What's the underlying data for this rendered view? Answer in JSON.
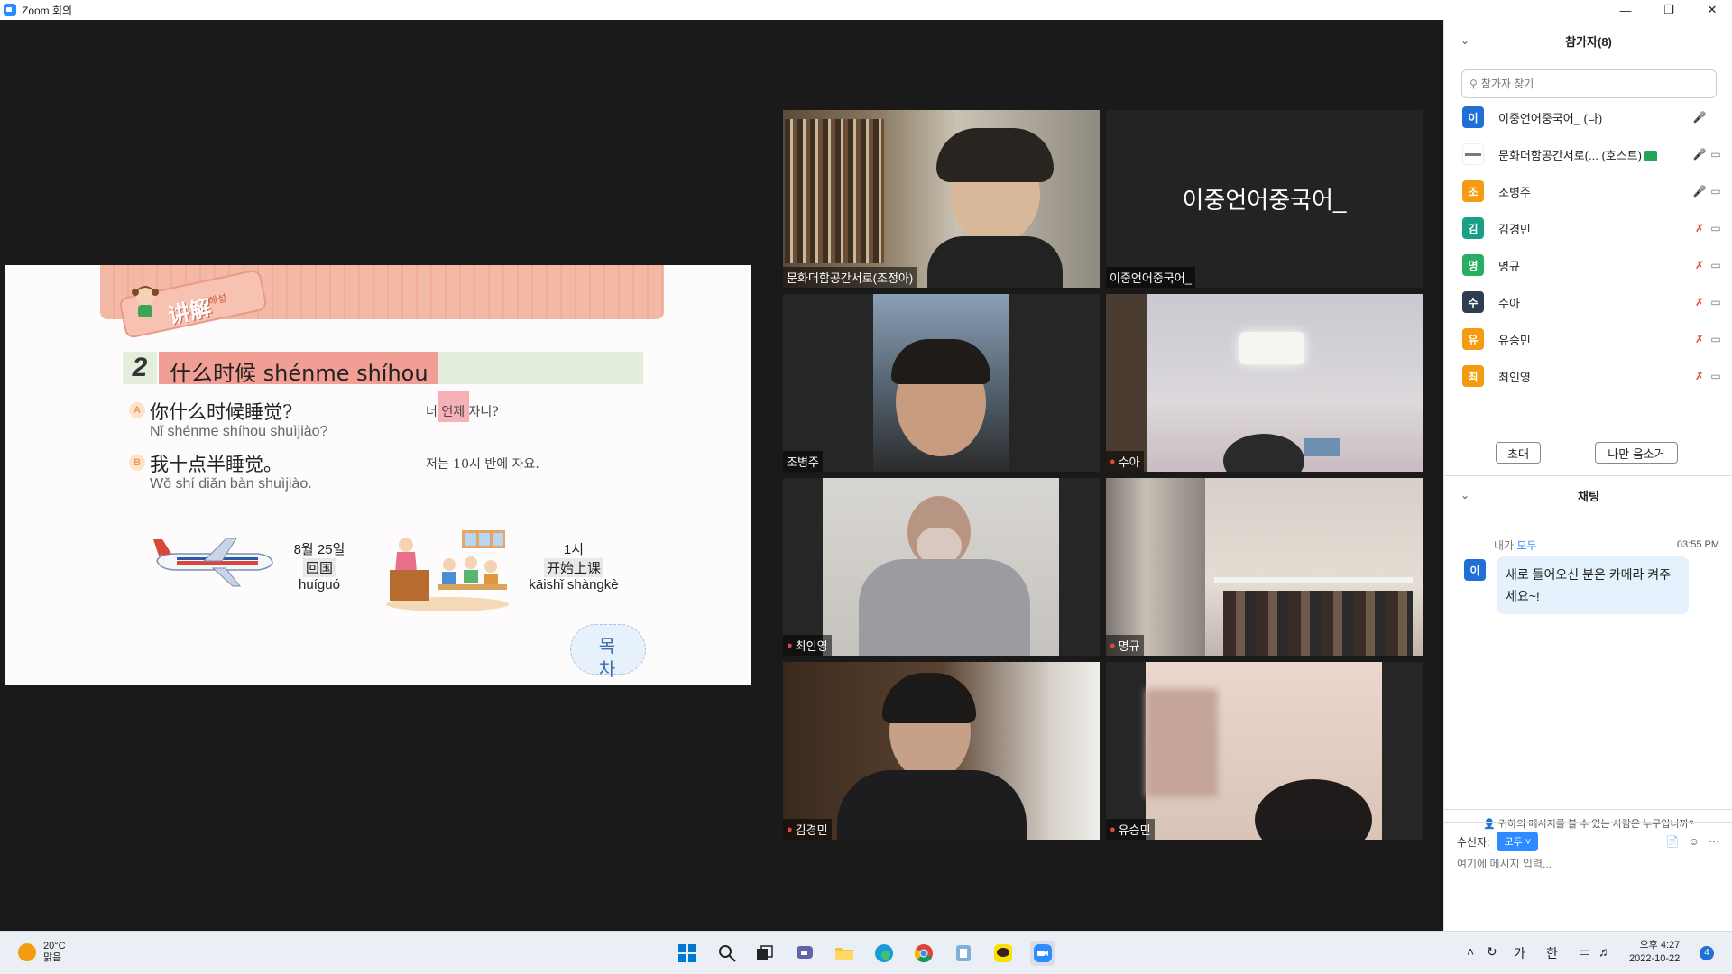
{
  "window": {
    "title": "Zoom 회의"
  },
  "slide": {
    "tag": "讲解",
    "tag_sub": "해설",
    "section_num": "2",
    "heading": "什么时候 shénme shíhou",
    "a_badge": "A",
    "a_zh": "你什么时候睡觉?",
    "a_py": "Nǐ shénme shíhou shuìjiào?",
    "a_kr": "너 언제 자니?",
    "b_badge": "B",
    "b_zh": "我十点半睡觉。",
    "b_py": "Wǒ shí diǎn bàn shuìjiào.",
    "b_kr": "저는 10시 반에 자요.",
    "img1_date": "8월 25일",
    "img1_zh": "回国",
    "img1_py": "huíguó",
    "img2_time": "1시",
    "img2_zh": "开始上课",
    "img2_py": "kāishǐ shàngkè",
    "cloud": "목차"
  },
  "tiles": [
    {
      "name": "문화더함공간서로(조정아)",
      "muted": false
    },
    {
      "name": "이중언어중국어_",
      "muted": false,
      "video_off_label": "이중언어중국어_"
    },
    {
      "name": "조병주",
      "muted": false
    },
    {
      "name": "수아",
      "muted": true
    },
    {
      "name": "최인영",
      "muted": true
    },
    {
      "name": "명규",
      "muted": true
    },
    {
      "name": "김경민",
      "muted": true
    },
    {
      "name": "유승민",
      "muted": true
    }
  ],
  "participants": {
    "title": "참가자(8)",
    "search_placeholder": "참가자 찾기",
    "list": [
      {
        "initial": "이",
        "color": "#1f6fd6",
        "name": "이중언어중국어_ (나)",
        "mic": "on",
        "video": "none"
      },
      {
        "initial": "",
        "color": "#ffffff",
        "name": "문화더함공간서로(... (호스트)",
        "mic": "on",
        "video": "off",
        "host": true
      },
      {
        "initial": "조",
        "color": "#f39c12",
        "name": "조병주",
        "mic": "on",
        "video": "off"
      },
      {
        "initial": "김",
        "color": "#16a085",
        "name": "김경민",
        "mic": "muted",
        "video": "off"
      },
      {
        "initial": "명",
        "color": "#27ae60",
        "name": "명규",
        "mic": "muted",
        "video": "off"
      },
      {
        "initial": "수",
        "color": "#2c3e50",
        "name": "수아",
        "mic": "muted",
        "video": "off"
      },
      {
        "initial": "유",
        "color": "#f39c12",
        "name": "유승민",
        "mic": "muted",
        "video": "off"
      },
      {
        "initial": "최",
        "color": "#f39c12",
        "name": "최인영",
        "mic": "muted",
        "video": "off"
      }
    ],
    "invite_label": "초대",
    "mute_me_label": "나만 음소거"
  },
  "chat": {
    "title": "채팅",
    "sender": "내가",
    "to": "모두",
    "time": "03:55 PM",
    "avatar_initial": "이",
    "message": "새로 들어오신 분은 카메라 켜주세요~!",
    "who_can_see": "귀하의 메시지를 볼 수 있는 사람은 누구입니까?",
    "recipient_label": "수신자:",
    "recipient_value": "모두",
    "input_placeholder": "여기에 메시지 입력..."
  },
  "taskbar": {
    "temp": "20°C",
    "weather": "맑음",
    "ime_ga": "가",
    "ime_han": "한",
    "time": "오후 4:27",
    "date": "2022-10-22",
    "notif_count": "4"
  }
}
